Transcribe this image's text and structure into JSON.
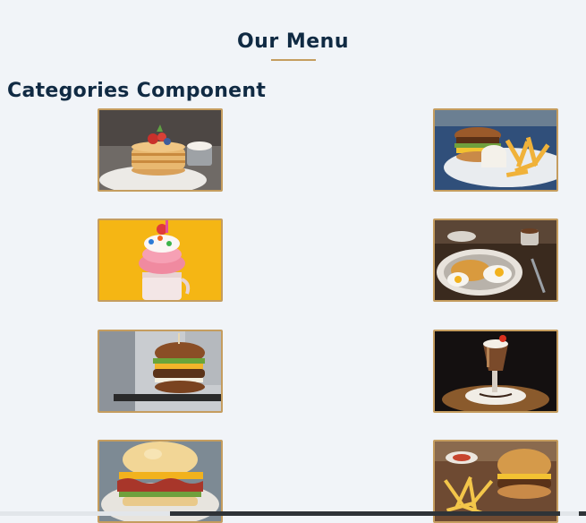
{
  "header": {
    "title": "Our Menu"
  },
  "component": {
    "title": "Categories Component"
  },
  "menu_items": [
    {
      "name": "pancakes-photo"
    },
    {
      "name": "burger-with-fries-photo"
    },
    {
      "name": "milkshake-photo"
    },
    {
      "name": "eggs-and-pasta-photo"
    },
    {
      "name": "stacked-burger-photo"
    },
    {
      "name": "chocolate-shake-photo"
    },
    {
      "name": "bacon-biscuit-sandwich-photo"
    },
    {
      "name": "burger-and-fries-photo"
    }
  ],
  "colors": {
    "background": "#f1f4f8",
    "heading": "#102a43",
    "accent": "#c59d5f"
  }
}
